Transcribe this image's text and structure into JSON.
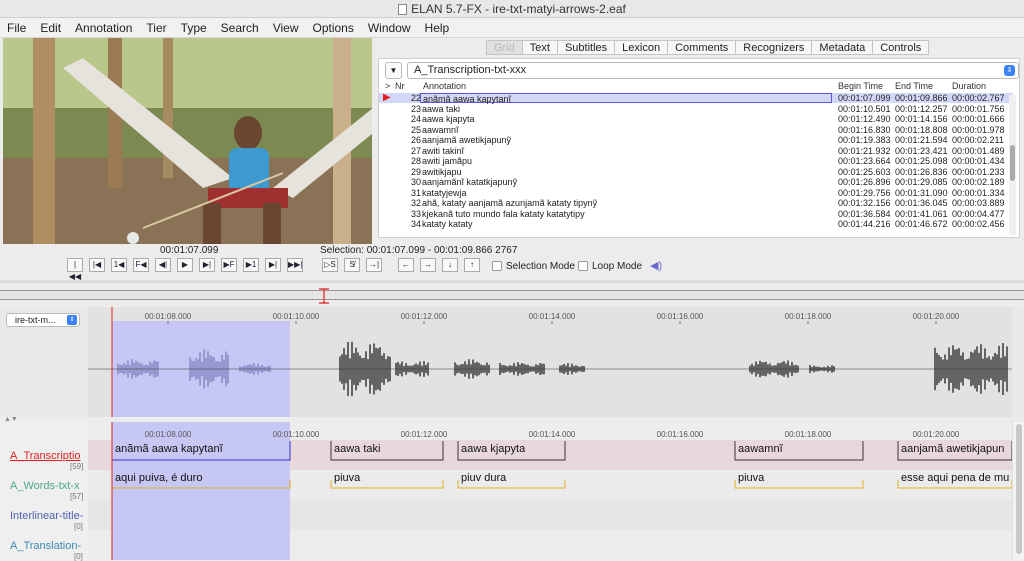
{
  "window": {
    "title": "ELAN 5.7-FX - ire-txt-matyi-arrows-2.eaf"
  },
  "menu": [
    "File",
    "Edit",
    "Annotation",
    "Tier",
    "Type",
    "Search",
    "View",
    "Options",
    "Window",
    "Help"
  ],
  "tabs": [
    "Grid",
    "Text",
    "Subtitles",
    "Lexicon",
    "Comments",
    "Recognizers",
    "Metadata",
    "Controls"
  ],
  "grid": {
    "tier": "A_Transcription-txt-xxx",
    "headers": {
      "marker": ">",
      "nr": "Nr",
      "annotation": "Annotation",
      "begin": "Begin Time",
      "end": "End Time",
      "duration": "Duration"
    },
    "rows": [
      {
        "nr": "22",
        "annotation": "anãmã aawa kapytanĩ",
        "begin": "00:01:07.099",
        "end": "00:01:09.866",
        "duration": "00:00:02.767",
        "selected": true
      },
      {
        "nr": "23",
        "annotation": "aawa taki",
        "begin": "00:01:10.501",
        "end": "00:01:12.257",
        "duration": "00:00:01.756"
      },
      {
        "nr": "24",
        "annotation": "aawa kjapyta",
        "begin": "00:01:12.490",
        "end": "00:01:14.156",
        "duration": "00:00:01.666"
      },
      {
        "nr": "25",
        "annotation": "aawamnĩ",
        "begin": "00:01:16.830",
        "end": "00:01:18.808",
        "duration": "00:00:01.978"
      },
      {
        "nr": "26",
        "annotation": "aanjamã awetikjapunỹ",
        "begin": "00:01:19.383",
        "end": "00:01:21.594",
        "duration": "00:00:02.211"
      },
      {
        "nr": "27",
        "annotation": "awiti takinĩ",
        "begin": "00:01:21.932",
        "end": "00:01:23.421",
        "duration": "00:00:01.489"
      },
      {
        "nr": "28",
        "annotation": "awiti jamãpu",
        "begin": "00:01:23.664",
        "end": "00:01:25.098",
        "duration": "00:00:01.434"
      },
      {
        "nr": "29",
        "annotation": "awitikjapu",
        "begin": "00:01:25.603",
        "end": "00:01:26.836",
        "duration": "00:00:01.233"
      },
      {
        "nr": "30",
        "annotation": "aanjamãnĩ katatkjapunỹ",
        "begin": "00:01:26.896",
        "end": "00:01:29.085",
        "duration": "00:00:02.189"
      },
      {
        "nr": "31",
        "annotation": "katatyjewja",
        "begin": "00:01:29.756",
        "end": "00:01:31.090",
        "duration": "00:00:01.334"
      },
      {
        "nr": "32",
        "annotation": "ahã, kataty aanjamã azunjamã kataty tipynỹ",
        "begin": "00:01:32.156",
        "end": "00:01:36.045",
        "duration": "00:00:03.889"
      },
      {
        "nr": "33",
        "annotation": "kjekanã tuto mundo fala kataty katatytipy",
        "begin": "00:01:36.584",
        "end": "00:01:41.061",
        "duration": "00:00:04.477"
      },
      {
        "nr": "34",
        "annotation": "kataty kataty",
        "begin": "00:01:44.216",
        "end": "00:01:46.672",
        "duration": "00:00:02.456"
      }
    ]
  },
  "player": {
    "time": "00:01:07.099",
    "selection": "Selection: 00:01:07.099 - 00:01:09.866  2767",
    "selection_mode": "Selection Mode",
    "loop_mode": "Loop Mode"
  },
  "waveform": {
    "selector": "ire-txt-m...",
    "ticks": [
      "00:01:08.000",
      "00:01:10.000",
      "00:01:12.000",
      "00:01:14.000",
      "00:01:16.000",
      "00:01:18.000",
      "00:01:20.000"
    ]
  },
  "tiers": [
    {
      "name": "A_Transcriptio",
      "count": "[59]",
      "color": "#e02020"
    },
    {
      "name": "A_Words-txt-x",
      "count": "[57]",
      "color": "#4aa88a"
    },
    {
      "name": "Interlinear-title-",
      "count": "[0]",
      "color": "#5060b0"
    },
    {
      "name": "A_Translation-",
      "count": "[0]",
      "color": "#3a8ab0"
    }
  ],
  "transcription_annotations": [
    "anãmã aawa kapytanĩ",
    "aawa taki",
    "aawa kjapyta",
    "aawamnĩ",
    "aanjamã awetikjapun"
  ],
  "words_annotations": [
    "aqui puiva, é duro",
    "piuva",
    "piuv dura",
    "piuva",
    "esse aqui pena de mu"
  ],
  "colors": {
    "selection": "#c7c7f5",
    "crosshair": "#e02020",
    "accent": "#3b82f6"
  }
}
